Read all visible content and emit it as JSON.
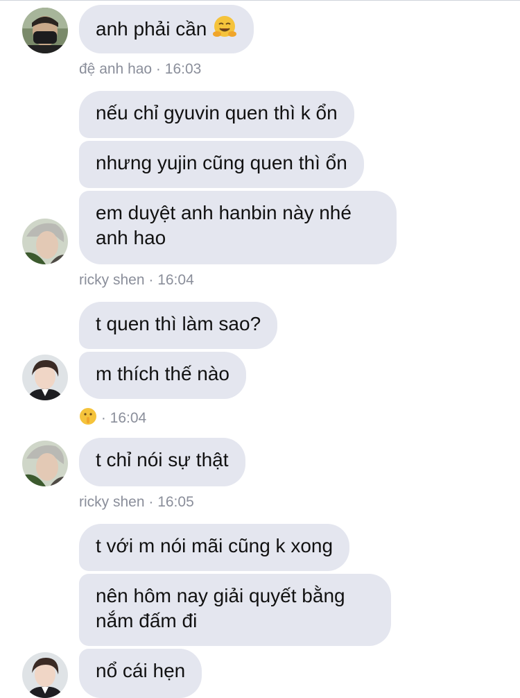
{
  "messages": {
    "m1": "anh phải cần",
    "m2": "nếu chỉ gyuvin quen thì k ổn",
    "m3": "nhưng yujin cũng quen thì ổn",
    "m4a": "em duyệt anh hanbin này nhé",
    "m4b": "anh hao",
    "m5": "t quen thì làm sao?",
    "m6": "m thích thế nào",
    "m7": "t chỉ nói sự thật",
    "m8": "t với m nói mãi cũng k xong",
    "m9a": "nên hôm nay giải quyết bằng",
    "m9b": "nắm đấm đi",
    "m10": "nổ cái hẹn"
  },
  "meta": {
    "g1": "đệ anh hao · 16:03",
    "g2": "ricky shen · 16:04",
    "g3": "· 16:04",
    "g4": "ricky shen · 16:05"
  },
  "icons": {
    "m1_emoji": "hugging-face-emoji",
    "g3_emoji": "shushing-face-emoji"
  },
  "colors": {
    "bubble_bg": "#e4e6ef",
    "meta_text": "#8a8e9a",
    "message_text": "#111111"
  }
}
